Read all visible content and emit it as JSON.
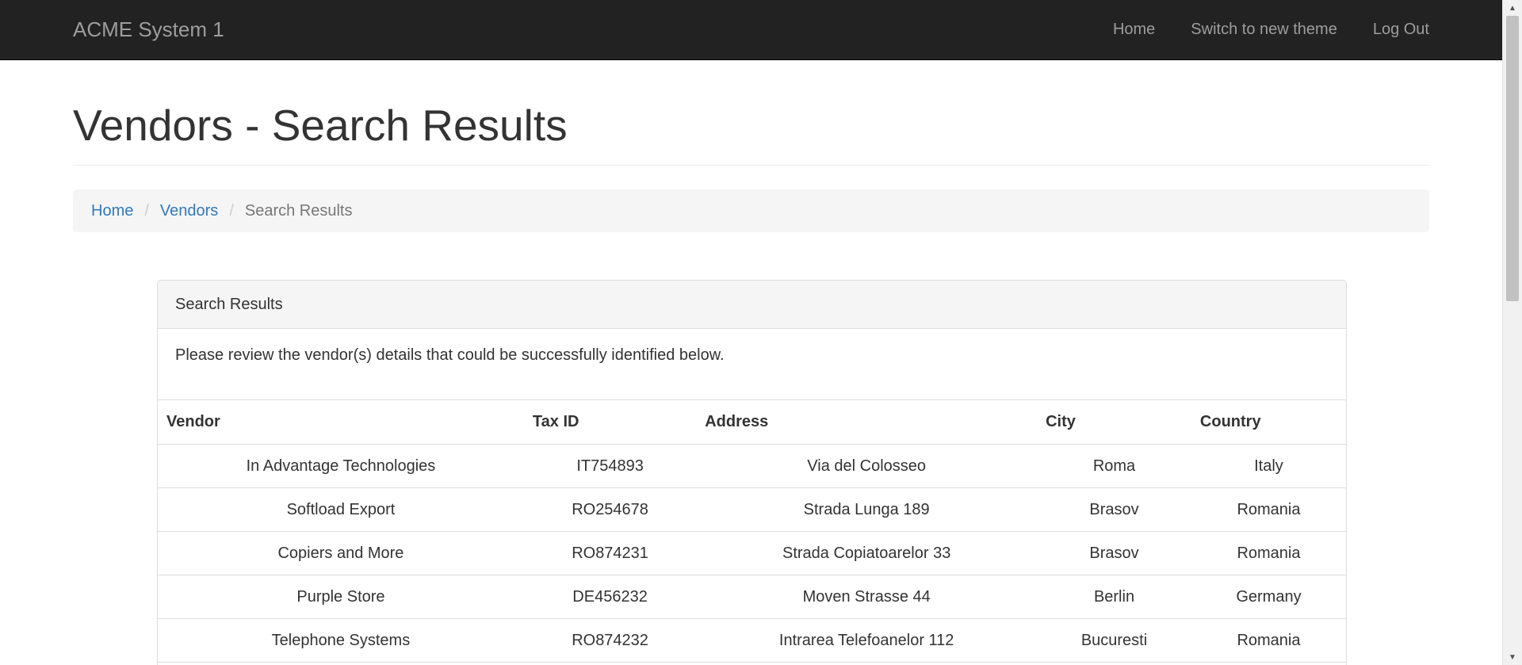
{
  "navbar": {
    "brand": "ACME System 1",
    "links": [
      "Home",
      "Switch to new theme",
      "Log Out"
    ]
  },
  "page": {
    "title": "Vendors - Search Results"
  },
  "breadcrumb": {
    "items": [
      "Home",
      "Vendors"
    ],
    "active": "Search Results",
    "separator": "/"
  },
  "panel": {
    "heading": "Search Results",
    "message": "Please review the vendor(s) details that could be successfully identified below."
  },
  "table": {
    "headers": [
      "Vendor",
      "Tax ID",
      "Address",
      "City",
      "Country"
    ],
    "rows": [
      [
        "In Advantage Technologies",
        "IT754893",
        "Via del Colosseo",
        "Roma",
        "Italy"
      ],
      [
        "Softload Export",
        "RO254678",
        "Strada Lunga 189",
        "Brasov",
        "Romania"
      ],
      [
        "Copiers and More",
        "RO874231",
        "Strada Copiatoarelor 33",
        "Brasov",
        "Romania"
      ],
      [
        "Purple Store",
        "DE456232",
        "Moven Strasse 44",
        "Berlin",
        "Germany"
      ],
      [
        "Telephone Systems",
        "RO874232",
        "Intrarea Telefoanelor 112",
        "Bucuresti",
        "Romania"
      ]
    ]
  },
  "scrollbar": {
    "up_icon": "triangle-up-icon",
    "down_icon": "triangle-down-icon"
  }
}
